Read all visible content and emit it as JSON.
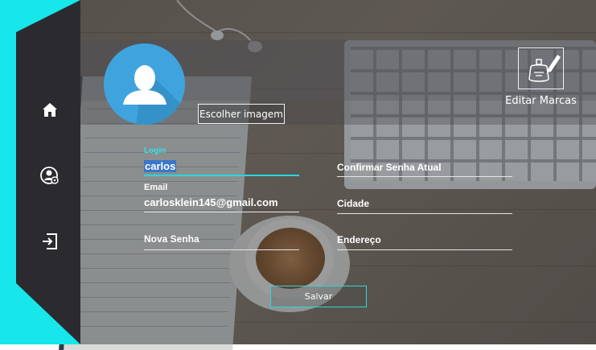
{
  "sidebar": {
    "accent_color": "#17e6ea",
    "items": [
      {
        "icon": "home-icon"
      },
      {
        "icon": "user-settings-icon"
      },
      {
        "icon": "logout-icon"
      }
    ]
  },
  "profile": {
    "avatar_icon": "user-avatar-icon",
    "choose_image_label": "Escolher imagem"
  },
  "edit_brands": {
    "icon": "perfume-edit-icon",
    "label": "Editar Marcas"
  },
  "form": {
    "login": {
      "label": "Login",
      "value": "carlos"
    },
    "email": {
      "label": "Email",
      "value": "carlosklein145@gmail.com"
    },
    "new_password": {
      "placeholder": "Nova Senha"
    },
    "confirm_password": {
      "placeholder": "Confirmar Senha Atual"
    },
    "city": {
      "placeholder": "Cidade"
    },
    "address": {
      "placeholder": "Endereço"
    },
    "save_label": "Salvar"
  },
  "colors": {
    "sidebar_bg": "#2b2b2f",
    "accent": "#2ad6de",
    "avatar_bg": "#3fa4de"
  }
}
